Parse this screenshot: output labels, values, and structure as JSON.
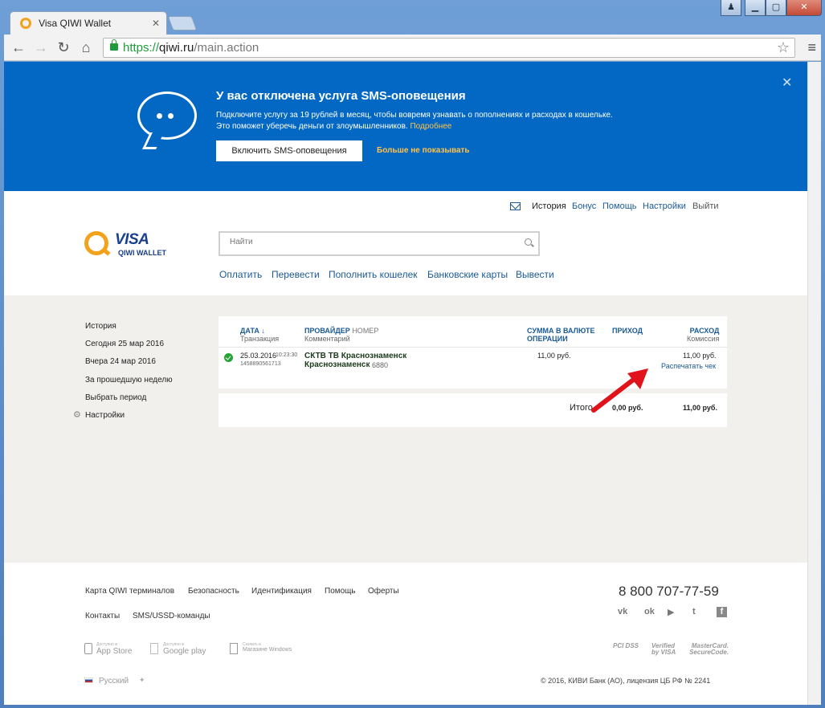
{
  "browser": {
    "tab_title": "Visa QIWI Wallet",
    "url_scheme": "https://",
    "url_host": "qiwi.ru",
    "url_path": "/main.action"
  },
  "banner": {
    "title": "У вас отключена услуга SMS-оповещения",
    "text_line1": "Подключите услугу за 19 рублей в месяц, чтобы вовремя узнавать о пополнениях и расходах в кошельке.",
    "text_line2": "Это поможет уберечь деньги от злоумышленников.",
    "more_link": "Подробнее",
    "enable_button": "Включить SMS-оповещения",
    "hide_link": "Больше не показывать"
  },
  "topnav": {
    "history": "История",
    "bonus": "Бонус",
    "help": "Помощь",
    "settings": "Настройки",
    "logout": "Выйти"
  },
  "logo": {
    "brand": "VISA",
    "sub": "QIWI WALLET"
  },
  "search": {
    "placeholder": "Найти"
  },
  "mainnav": [
    "Оплатить",
    "Перевести",
    "Пополнить кошелек",
    "Банковские карты",
    "Вывести"
  ],
  "sidebar": {
    "items": [
      "История",
      "Сегодня 25 мар 2016",
      "Вчера 24 мар 2016",
      "За прошедшую неделю",
      "Выбрать период"
    ],
    "settings": "Настройки"
  },
  "table": {
    "headers": {
      "date": "ДАТА",
      "date_arrow": "↓",
      "transaction": "Транзакция",
      "provider": "ПРОВАЙДЕР",
      "number": "НОМЕР",
      "comment": "Комментарий",
      "amount_line1": "СУММА В ВАЛЮТЕ",
      "amount_line2": "ОПЕРАЦИИ",
      "income": "ПРИХОД",
      "expense": "РАСХОД",
      "commission": "Комиссия"
    },
    "rows": [
      {
        "date": "25.03.2016",
        "time": "10:23:30",
        "transaction_id": "1458890561713",
        "provider_line1": "СКТВ ТВ Краснознаменск",
        "provider_line2": "Краснознаменск",
        "number": "6880",
        "amount": "11,00 руб.",
        "expense": "11,00 руб.",
        "print": "Распечатать чек"
      }
    ],
    "total_label": "Итого",
    "total_income": "0,00 руб.",
    "total_expense": "11,00 руб."
  },
  "footer": {
    "links_row1": [
      "Карта QIWI терминалов",
      "Безопасность",
      "Идентификация",
      "Помощь",
      "Оферты"
    ],
    "links_row2": [
      "Контакты",
      "SMS/USSD-команды"
    ],
    "phone": "8 800 707-77-59",
    "social": [
      "vk-icon",
      "odnoklassniki-icon",
      "youtube-icon",
      "twitter-icon",
      "facebook-icon"
    ],
    "stores": [
      {
        "small": "Доступно в",
        "name": "App Store"
      },
      {
        "small": "Доступно в",
        "name": "Google play"
      },
      {
        "small": "Скачать в",
        "name": "Магазине Windows"
      }
    ],
    "certs": [
      "PCI DSS",
      "Verified by VISA",
      "MasterCard. SecureCode."
    ],
    "language": "Русский",
    "copyright": "© 2016, КИВИ Банк (АО), лицензия ЦБ РФ № 2241"
  },
  "colors": {
    "banner": "#0368c4",
    "link": "#1a5a96",
    "accent": "#f3a21b",
    "success": "#27a235",
    "annotation_arrow": "#e0131b"
  }
}
